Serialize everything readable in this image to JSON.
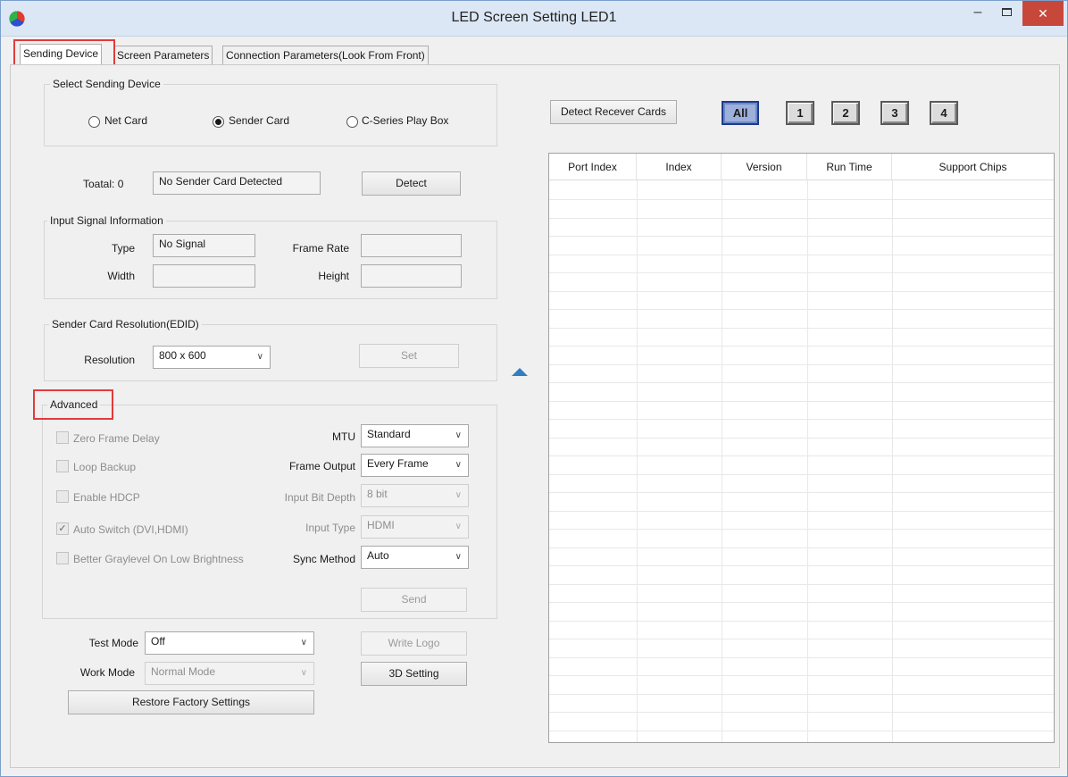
{
  "window": {
    "title": "LED Screen Setting LED1",
    "minimize": "–",
    "maximize": "□",
    "close": "✕"
  },
  "tabs": [
    {
      "label": "Sending Device",
      "active": true
    },
    {
      "label": "Screen Parameters",
      "active": false
    },
    {
      "label": "Connection Parameters(Look From Front)",
      "active": false
    }
  ],
  "select_device": {
    "title": "Select Sending Device",
    "options": [
      {
        "label": "Net Card",
        "selected": false
      },
      {
        "label": "Sender Card",
        "selected": true
      },
      {
        "label": "C-Series Play Box",
        "selected": false
      }
    ]
  },
  "detect_row": {
    "total_label": "Toatal: 0",
    "status_value": "No Sender Card Detected",
    "detect_button": "Detect"
  },
  "input_signal": {
    "title": "Input Signal Information",
    "type_label": "Type",
    "type_value": "No Signal",
    "frame_rate_label": "Frame Rate",
    "frame_rate_value": "",
    "width_label": "Width",
    "width_value": "",
    "height_label": "Height",
    "height_value": ""
  },
  "resolution": {
    "title": "Sender Card Resolution(EDID)",
    "label": "Resolution",
    "value": "800 x 600",
    "set_button": "Set"
  },
  "advanced": {
    "title": "Advanced",
    "zero_frame_delay": {
      "label": "Zero Frame Delay",
      "checked": false
    },
    "loop_backup": {
      "label": "Loop Backup",
      "checked": false
    },
    "enable_hdcp": {
      "label": "Enable HDCP",
      "checked": false
    },
    "auto_switch": {
      "label": "Auto Switch (DVI,HDMI)",
      "checked": true
    },
    "better_graylevel": {
      "label": "Better Graylevel On Low Brightness",
      "checked": false
    },
    "mtu_label": "MTU",
    "mtu_value": "Standard",
    "frame_output_label": "Frame Output",
    "frame_output_value": "Every Frame",
    "input_bit_depth_label": "Input Bit Depth",
    "input_bit_depth_value": "8 bit",
    "input_type_label": "Input Type",
    "input_type_value": "HDMI",
    "sync_method_label": "Sync Method",
    "sync_method_value": "Auto",
    "send_button": "Send"
  },
  "bottom": {
    "test_mode_label": "Test Mode",
    "test_mode_value": "Off",
    "work_mode_label": "Work Mode",
    "work_mode_value": "Normal Mode",
    "write_logo_button": "Write Logo",
    "setting_3d_button": "3D Setting",
    "restore_button": "Restore Factory Settings"
  },
  "receiver": {
    "detect_button": "Detect Recever Cards",
    "port_buttons": [
      "All",
      "1",
      "2",
      "3",
      "4"
    ],
    "columns": [
      "Port Index",
      "Index",
      "Version",
      "Run Time",
      "Support Chips"
    ]
  },
  "icons": {
    "collapse": "triangle-up-icon",
    "chevron": "▾"
  },
  "colors": {
    "highlight": "#e23b3b",
    "accent_blue": "#2f7fc1",
    "close_red": "#c7483b"
  }
}
